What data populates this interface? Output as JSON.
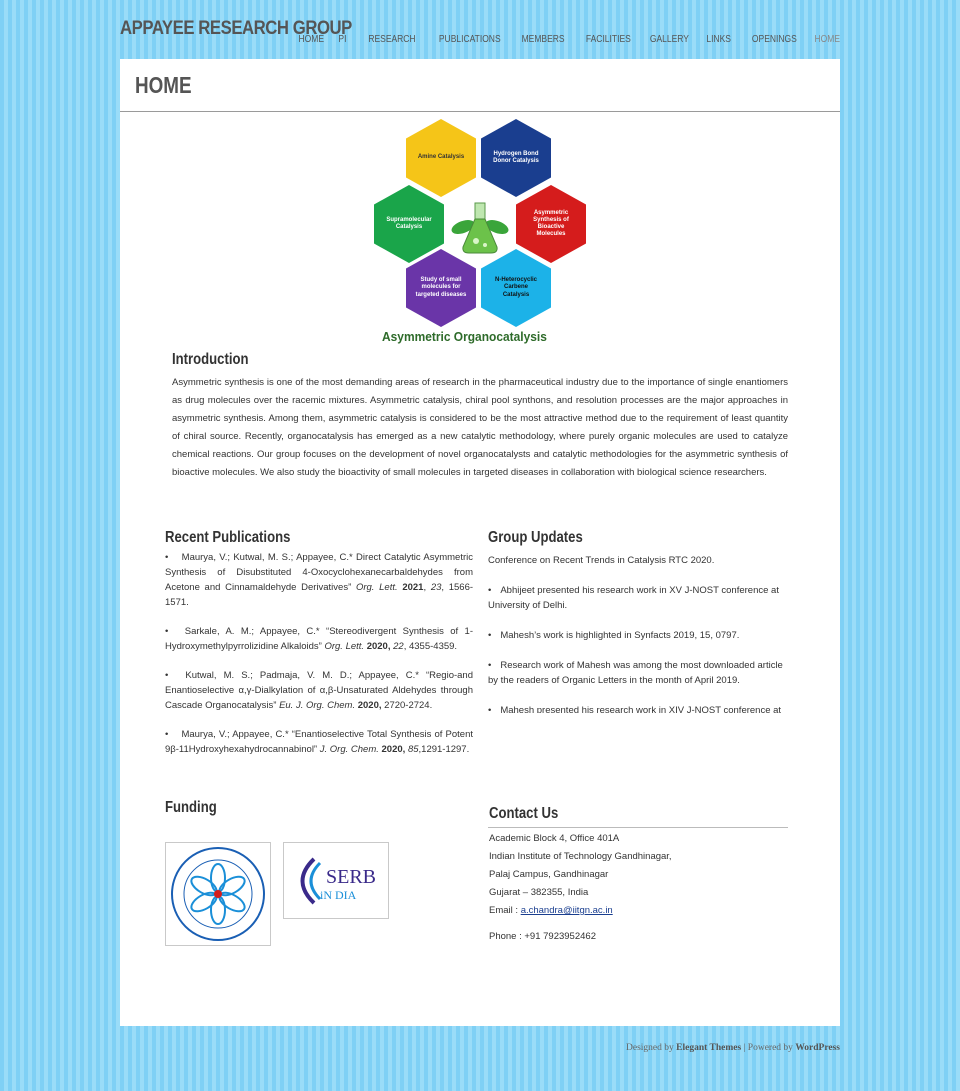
{
  "site": {
    "title": "APPAYEE RESEARCH GROUP"
  },
  "nav": [
    {
      "label": "HOME"
    },
    {
      "label": "PI"
    },
    {
      "label": "RESEARCH"
    },
    {
      "label": "PUBLICATIONS"
    },
    {
      "label": "MEMBERS"
    },
    {
      "label": "FACILITIES"
    },
    {
      "label": "GALLERY"
    },
    {
      "label": "LINKS"
    },
    {
      "label": "OPENINGS"
    },
    {
      "label": "HOME"
    }
  ],
  "page": {
    "title": "HOME"
  },
  "figure": {
    "hexes": [
      "Amine Catalysis",
      "Hydrogen Bond Donor Catalysis",
      "Supramolecular Catalysis",
      "Asymmetric Synthesis of Bioactive Molecules",
      "Study of small molecules for targeted diseases",
      "N-Heterocyclic Carbene Catalysis"
    ],
    "caption": "Asymmetric Organocatalysis",
    "colors": {
      "yellow": "#f5c518",
      "navy": "#1a3e8f",
      "green": "#1aa54a",
      "red": "#d51c1c",
      "purple": "#6a35a8",
      "cyan": "#1cb2e8"
    }
  },
  "intro": {
    "heading": "Introduction",
    "text": "Asymmetric synthesis is one of the most demanding areas of research in the pharmaceutical industry due to the importance of single enantiomers as drug molecules over the racemic mixtures. Asymmetric catalysis, chiral pool synthons, and resolution processes are the major approaches in asymmetric synthesis. Among them, asymmetric catalysis is considered to be the most attractive method due to the requirement of least quantity of chiral source. Recently, organocatalysis has emerged as a new catalytic methodology, where purely organic molecules are used to catalyze chemical reactions. Our group focuses on the development of novel organocatalysts and catalytic methodologies for the asymmetric synthesis of bioactive molecules. We also study the bioactivity of small molecules in targeted diseases in collaboration with biological science researchers."
  },
  "publications": {
    "heading": "Recent Publications",
    "items": [
      {
        "authors": "Maurya, V.; Kutwal, M. S.; Appayee, C.* Direct Catalytic Asymmetric Synthesis of Disubstituted 4-Oxocyclohexanecarbaldehydes from Acetone and Cinnamaldehyde Derivatives”",
        "journal": "Org. Lett.",
        "year": "2021",
        "vol": "23",
        "pages": ", 1566-1571."
      },
      {
        "authors": "Sarkale, A. M.; Appayee, C.* “Stereodivergent Synthesis of 1-Hydroxymethylpyrrolizidine Alkaloids”",
        "journal": "Org. Lett.",
        "year": "2020,",
        "vol": "22",
        "pages": ", 4355-4359."
      },
      {
        "authors": "Kutwal, M. S.; Padmaja, V. M. D.; Appayee, C.* “Regio-and Enantioselective α,γ-Dialkylation of α,β-Unsaturated Aldehydes through Cascade Organocatalysis”",
        "journal": "Eu. J. Org. Chem.",
        "year": "2020,",
        "vol": "",
        "pages": " 2720-2724."
      },
      {
        "authors": "Maurya, V.; Appayee, C.* “Enantioselective Total Synthesis of Potent 9β-11Hydroxyhexahydrocannabinol”",
        "journal": "J. Org. Chem.",
        "year": "2020,",
        "vol": "85",
        "pages": ",1291-1297."
      }
    ]
  },
  "updates": {
    "heading": "Group Updates",
    "lead": "Conference on Recent Trends in Catalysis RTC 2020.",
    "items": [
      "Abhijeet presented his research work in XV J-NOST conference at University of Delhi.",
      "Mahesh’s work is highlighted in Synfacts 2019, 15, 0797.",
      "Research work of Mahesh was among the most downloaded article by the readers of Organic Letters in the month of April 2019.",
      "Mahesh presented his research work in XIV J-NOST conference at"
    ]
  },
  "funding": {
    "heading": "Funding",
    "logos": [
      {
        "name": "iitgn-logo",
        "text": "Indian Institute of Technology Gandhinagar"
      },
      {
        "name": "serb-logo",
        "text": "SERB",
        "sub": "iN DIA"
      }
    ]
  },
  "contact": {
    "heading": "Contact Us",
    "lines": [
      "Academic Block 4, Office 401A",
      "Indian Institute of Technology Gandhinagar,",
      "Palaj Campus, Gandhinagar",
      "Gujarat – 382355, India"
    ],
    "email_label": "Email  :",
    "email": "a.chandra@iitgn.ac.in",
    "phone": "Phone : +91 7923952462"
  },
  "footer": {
    "designed_by": "Designed by",
    "theme_author": "Elegant Themes",
    "separator": " | Powered by ",
    "platform": "WordPress"
  }
}
